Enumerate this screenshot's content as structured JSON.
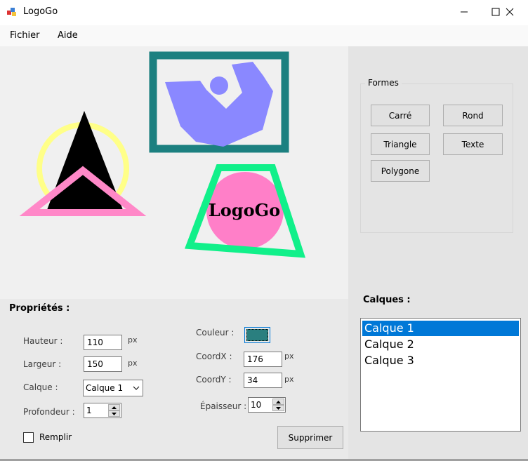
{
  "window": {
    "title": "LogoGo"
  },
  "menu": {
    "items": [
      "Fichier",
      "Aide"
    ]
  },
  "canvas": {
    "text_shape": "LogoGo"
  },
  "properties": {
    "heading": "Propriétés :",
    "height_label": "Hauteur :",
    "height_value": "110",
    "width_label": "Largeur :",
    "width_value": "150",
    "layer_label": "Calque :",
    "layer_value": "Calque 1",
    "depth_label": "Profondeur :",
    "depth_value": "1",
    "fill_label": "Remplir",
    "color_label": "Couleur :",
    "color_value": "#2a7f7f",
    "coordx_label": "CoordX :",
    "coordx_value": "176",
    "coordy_label": "CoordY :",
    "coordy_value": "34",
    "thickness_label": "Épaisseur :",
    "thickness_value": "10",
    "unit": "px",
    "delete_label": "Supprimer"
  },
  "shapes_group": {
    "title": "Formes",
    "buttons": [
      "Carré",
      "Rond",
      "Triangle",
      "Texte",
      "Polygone"
    ]
  },
  "layers": {
    "title": "Calques :",
    "items": [
      "Calque 1",
      "Calque 2",
      "Calque 3"
    ],
    "selected_index": 0
  }
}
